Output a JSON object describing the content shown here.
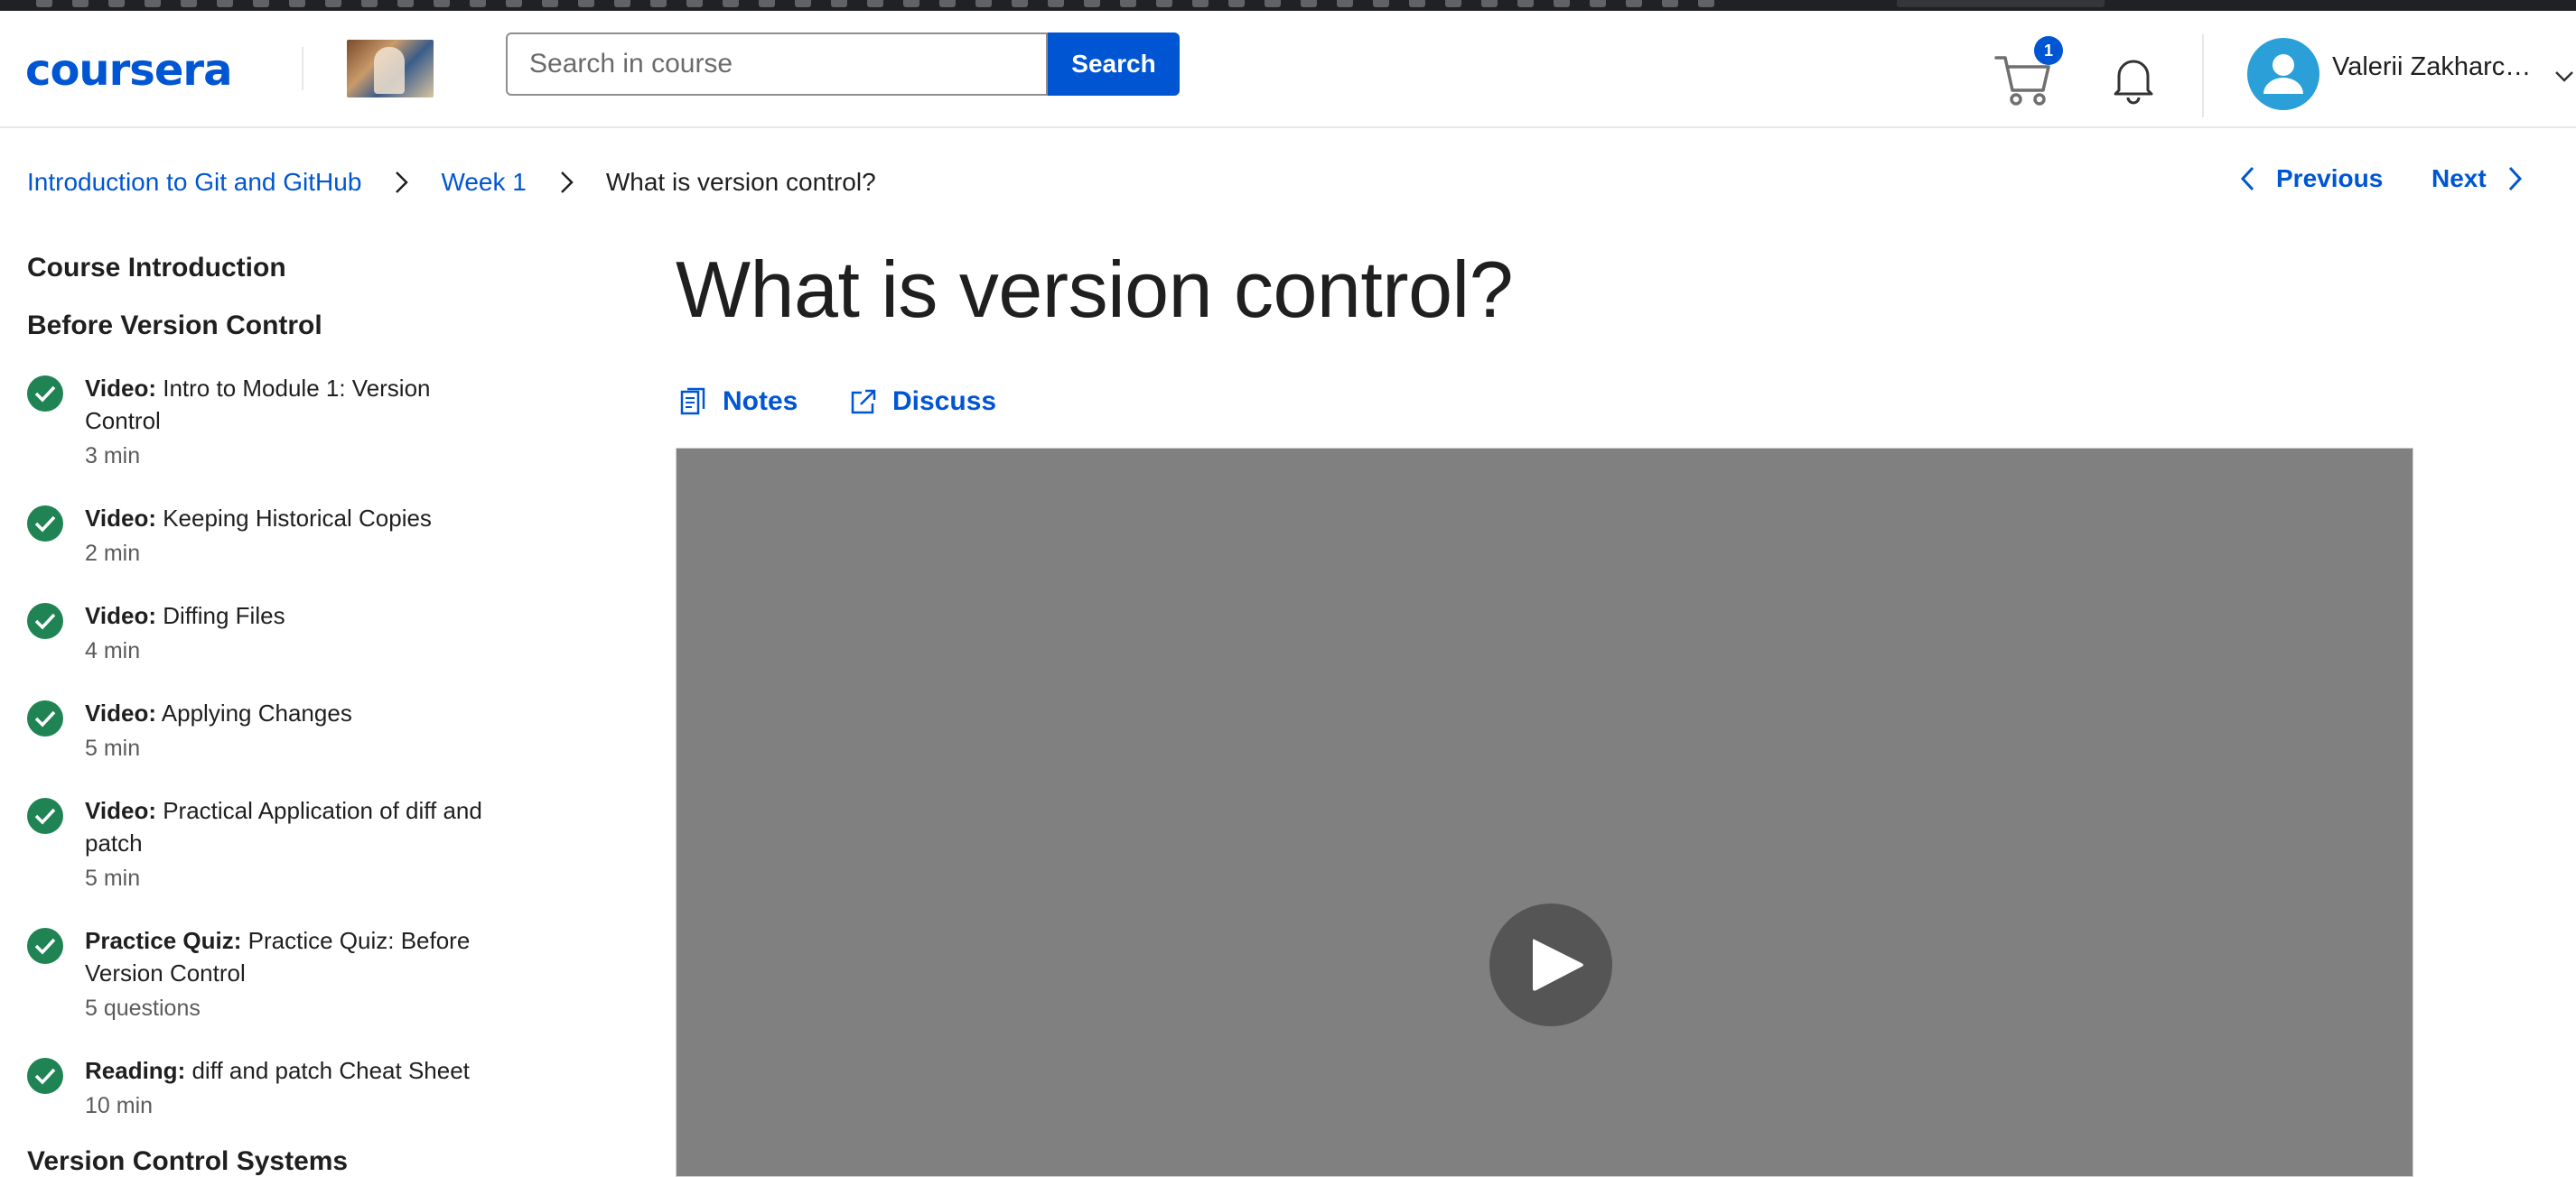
{
  "header": {
    "logo_text": "coursera",
    "search": {
      "placeholder": "Search in course",
      "button_label": "Search"
    },
    "cart_count": "1",
    "user_name": "Valerii Zakharche..."
  },
  "breadcrumb": {
    "course": "Introduction to Git and GitHub",
    "week": "Week 1",
    "current": "What is version control?"
  },
  "nav": {
    "previous": "Previous",
    "next": "Next"
  },
  "sidebar": {
    "section_1": "Course Introduction",
    "section_2": "Before Version Control",
    "items": [
      {
        "kind": "Video:",
        "title": "Intro to Module 1: Version Control",
        "meta": "3 min"
      },
      {
        "kind": "Video:",
        "title": "Keeping Historical Copies",
        "meta": "2 min"
      },
      {
        "kind": "Video:",
        "title": "Diffing Files",
        "meta": "4 min"
      },
      {
        "kind": "Video:",
        "title": "Applying Changes",
        "meta": "5 min"
      },
      {
        "kind": "Video:",
        "title": "Practical Application of diff and patch",
        "meta": "5 min"
      },
      {
        "kind": "Practice Quiz:",
        "title": "Practice Quiz: Before Version Control",
        "meta": "5 questions"
      },
      {
        "kind": "Reading:",
        "title": "diff and patch Cheat Sheet",
        "meta": "10 min"
      }
    ],
    "section_3": "Version Control Systems"
  },
  "main": {
    "title": "What is version control?",
    "notes_label": "Notes",
    "discuss_label": "Discuss"
  },
  "colors": {
    "brand": "#0056d2",
    "complete": "#1f8354",
    "video_bg": "#808080"
  }
}
